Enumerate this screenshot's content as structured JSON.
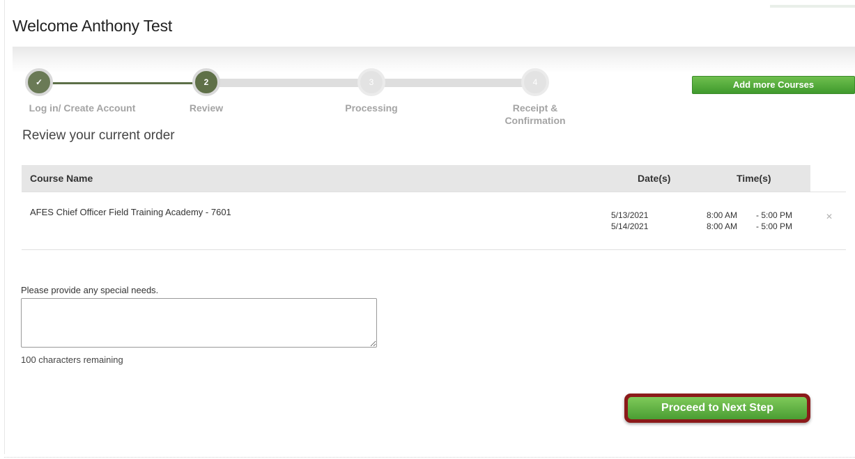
{
  "header": {
    "welcome": "Welcome Anthony Test"
  },
  "progress": {
    "steps": [
      {
        "label": "Log in/ Create Account",
        "marker": "✓",
        "state": "done"
      },
      {
        "label": "Review",
        "marker": "2",
        "state": "current"
      },
      {
        "label": "Processing",
        "marker": "3",
        "state": "future"
      },
      {
        "label": "Receipt & Confirmation",
        "marker": "4",
        "state": "future"
      }
    ]
  },
  "actions": {
    "add_courses": "Add more Courses",
    "proceed": "Proceed to Next Step"
  },
  "order": {
    "title": "Review your current order",
    "columns": {
      "course": "Course Name",
      "dates": "Date(s)",
      "times": "Time(s)"
    },
    "rows": [
      {
        "course": "AFES Chief Officer Field Training Academy - 7601",
        "dates": [
          "5/13/2021",
          "5/14/2021"
        ],
        "start_times": [
          "8:00 AM",
          "8:00 AM"
        ],
        "end_times": [
          "- 5:00 PM",
          "- 5:00 PM"
        ]
      }
    ]
  },
  "special_needs": {
    "label": "Please provide any special needs.",
    "value": "",
    "remaining": "100 characters remaining"
  },
  "colors": {
    "accent_green": "#4a9d33",
    "step_done": "#5f7048",
    "highlight_border": "#8b1a1a"
  },
  "icons": {
    "remove": "close-x-icon",
    "done_step": "checkmark-icon"
  }
}
